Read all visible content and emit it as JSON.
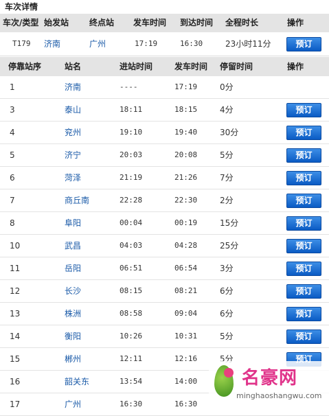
{
  "title": "车次详情",
  "summary_header": {
    "train_type": "车次/类型",
    "origin": "始发站",
    "terminal": "终点站",
    "depart_time": "发车时间",
    "arrive_time": "到达时间",
    "duration": "全程时长",
    "operation": "操作"
  },
  "summary": {
    "train": "T179",
    "origin": "济南",
    "terminal": "广州",
    "depart_time": "17:19",
    "arrive_time": "16:30",
    "duration": "23小时11分",
    "book_label": "预订"
  },
  "stops_header": {
    "seq": "停靠站序",
    "station": "站名",
    "arrive": "进站时间",
    "depart": "发车时间",
    "stay": "停留时间",
    "operation": "操作"
  },
  "stops": [
    {
      "seq": "1",
      "station": "济南",
      "arrive": "----",
      "depart": "17:19",
      "stay": "0分",
      "book": ""
    },
    {
      "seq": "3",
      "station": "泰山",
      "arrive": "18:11",
      "depart": "18:15",
      "stay": "4分",
      "book": "预订"
    },
    {
      "seq": "4",
      "station": "兖州",
      "arrive": "19:10",
      "depart": "19:40",
      "stay": "30分",
      "book": "预订"
    },
    {
      "seq": "5",
      "station": "济宁",
      "arrive": "20:03",
      "depart": "20:08",
      "stay": "5分",
      "book": "预订"
    },
    {
      "seq": "6",
      "station": "菏泽",
      "arrive": "21:19",
      "depart": "21:26",
      "stay": "7分",
      "book": "预订"
    },
    {
      "seq": "7",
      "station": "商丘南",
      "arrive": "22:28",
      "depart": "22:30",
      "stay": "2分",
      "book": "预订"
    },
    {
      "seq": "8",
      "station": "阜阳",
      "arrive": "00:04",
      "depart": "00:19",
      "stay": "15分",
      "book": "预订"
    },
    {
      "seq": "10",
      "station": "武昌",
      "arrive": "04:03",
      "depart": "04:28",
      "stay": "25分",
      "book": "预订"
    },
    {
      "seq": "11",
      "station": "岳阳",
      "arrive": "06:51",
      "depart": "06:54",
      "stay": "3分",
      "book": "预订"
    },
    {
      "seq": "12",
      "station": "长沙",
      "arrive": "08:15",
      "depart": "08:21",
      "stay": "6分",
      "book": "预订"
    },
    {
      "seq": "13",
      "station": "株洲",
      "arrive": "08:58",
      "depart": "09:04",
      "stay": "6分",
      "book": "预订"
    },
    {
      "seq": "14",
      "station": "衡阳",
      "arrive": "10:26",
      "depart": "10:31",
      "stay": "5分",
      "book": "预订"
    },
    {
      "seq": "15",
      "station": "郴州",
      "arrive": "12:11",
      "depart": "12:16",
      "stay": "5分",
      "book": "预订"
    },
    {
      "seq": "16",
      "station": "韶关东",
      "arrive": "13:54",
      "depart": "14:00",
      "stay": "",
      "book": ""
    },
    {
      "seq": "17",
      "station": "广州",
      "arrive": "16:30",
      "depart": "16:30",
      "stay": "",
      "book": ""
    }
  ],
  "watermark": {
    "brand": "名豪网",
    "url": "minghaoshangwu.com"
  }
}
